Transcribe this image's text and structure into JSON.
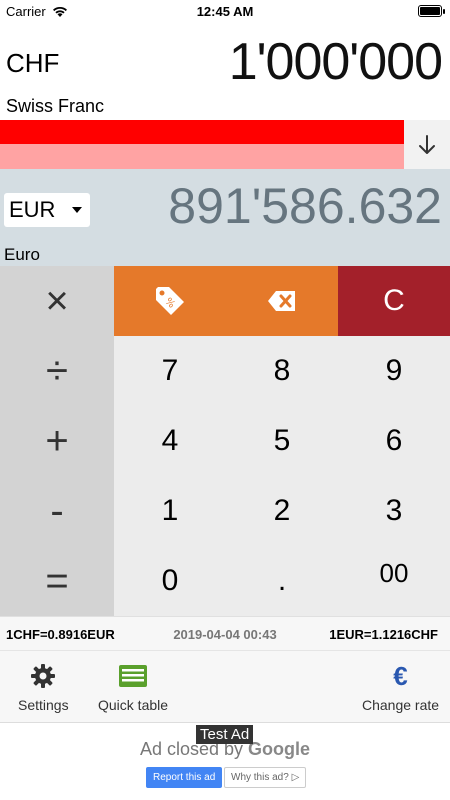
{
  "status": {
    "carrier": "Carrier",
    "time": "12:45 AM"
  },
  "source": {
    "code": "CHF",
    "value": "1'000'000",
    "name": "Swiss Franc"
  },
  "target": {
    "code": "EUR",
    "value": "891'586.632",
    "name": "Euro"
  },
  "keypad": {
    "multiply": "×",
    "divide": "÷",
    "plus": "+",
    "minus": "-",
    "equals": "=",
    "clear": "C",
    "k7": "7",
    "k8": "8",
    "k9": "9",
    "k4": "4",
    "k5": "5",
    "k6": "6",
    "k1": "1",
    "k2": "2",
    "k3": "3",
    "k0": "0",
    "kdot": ".",
    "k00": "00"
  },
  "rates": {
    "left": "1CHF=0.8916EUR",
    "date": "2019-04-04 00:43",
    "right": "1EUR=1.1216CHF"
  },
  "toolbar": {
    "settings": "Settings",
    "quick_table": "Quick table",
    "change_rate": "Change rate"
  },
  "ad": {
    "test_label": "Test Ad",
    "closed_text": "Ad closed by ",
    "closed_brand": "Google",
    "report": "Report this ad",
    "why": "Why this ad? ▷"
  },
  "colors": {
    "red_bar": "#ff0000",
    "pink_bar": "#ffa3a3",
    "orange": "#e5792a",
    "clear_red": "#a3202a",
    "quick_table_green": "#5aa02c",
    "euro_blue": "#2a58b0"
  }
}
